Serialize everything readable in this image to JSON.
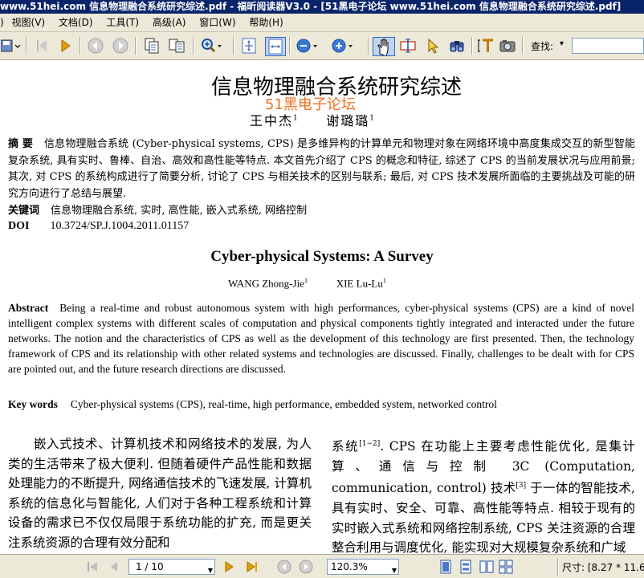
{
  "window": {
    "title": "www.51hei.com 信息物理融合系统研究综述.pdf - 福昕阅读器V3.0 - [51黑电子论坛 www.51hei.com 信息物理融合系统研究综述.pdf]"
  },
  "menu": {
    "items": [
      "视图(V)",
      "文档(D)",
      "工具(T)",
      "高级(A)",
      "窗口(W)",
      "帮助(H)"
    ]
  },
  "toolbar": {
    "search_label": "查找:",
    "search_value": ""
  },
  "document": {
    "title_cn": "信息物理融合系统研究综述",
    "watermark": "51黑电子论坛",
    "author1_cn": "王中杰",
    "author1_sup": "1",
    "author2_cn": "谢璐璐",
    "author2_sup": "1",
    "abstract_cn_label": "摘 要",
    "abstract_cn": "信息物理融合系统 (Cyber-physical systems, CPS) 是多维异构的计算单元和物理对象在网络环境中高度集成交互的新型智能复杂系统, 具有实时、鲁棒、自治、高效和高性能等特点. 本文首先介绍了 CPS 的概念和特征, 综述了 CPS 的当前发展状况与应用前景; 其次, 对 CPS 的系统构成进行了简要分析, 讨论了 CPS 与相关技术的区别与联系; 最后, 对 CPS 技术发展所面临的主要挑战及可能的研究方向进行了总结与展望.",
    "keywords_cn_label": "关键词",
    "keywords_cn": "信息物理融合系统, 实时, 高性能, 嵌入式系统, 网络控制",
    "doi_label": "DOI",
    "doi": "10.3724/SP.J.1004.2011.01157",
    "title_en": "Cyber-physical Systems: A Survey",
    "author1_en": "WANG Zhong-Jie",
    "author1_en_sup": "1",
    "author2_en": "XIE Lu-Lu",
    "author2_en_sup": "1",
    "abstract_en_label": "Abstract",
    "abstract_en": "Being a real-time and robust autonomous system with high performances, cyber-physical systems (CPS) are a kind of novel intelligent complex systems with different scales of computation and physical components tightly integrated and interacted under the future networks. The notion and the characteristics of CPS as well as the development of this technology are first presented. Then, the technology framework of CPS and its relationship with other related systems and technologies are discussed. Finally, challenges to be dealt with for CPS are pointed out, and the future research directions are discussed.",
    "keywords_en_label": "Key words",
    "keywords_en": "Cyber-physical systems (CPS), real-time, high performance, embedded system, networked control",
    "body_left": "嵌入式技术、计算机技术和网络技术的发展, 为人类的生活带来了极大便利. 但随着硬件产品性能和数据处理能力的不断提升, 网络通信技术的飞速发展, 计算机系统的信息化与智能化, 人们对于各种工程系统和计算设备的需求已不仅仅局限于系统功能的扩充, 而是更关注系统资源的合理有效分配和",
    "body_right_a": "系统",
    "body_right_ref1": "[1−2]",
    "body_right_b": ". CPS 在功能上主要考虑性能优化, 是集计算、通信与控制 3C (Computation, communication, control) 技术",
    "body_right_ref2": "[3]",
    "body_right_c": " 于一体的智能技术, 具有实时、安全、可靠、高性能等特点. 相较于现有的实时嵌入式系统和网络控制系统, CPS 关注资源的合理整合利用与调度优化, 能实现对大规模复杂系统和广域"
  },
  "status": {
    "page_value": "1 / 10",
    "zoom_value": "120.3%",
    "size_text": "尺寸: [8.27 * 11.6"
  }
}
